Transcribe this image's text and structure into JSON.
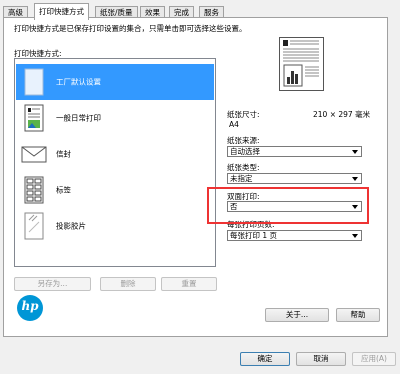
{
  "tabs": [
    "高级",
    "打印快捷方式",
    "纸张/质量",
    "效果",
    "完成",
    "服务"
  ],
  "active_tab": "打印快捷方式",
  "description": "打印快捷方式是已保存打印设置的集合，只需单击即可选择这些设置。",
  "shortcuts_label": "打印快捷方式:",
  "shortcuts": [
    {
      "label": "工厂默认设置",
      "icon": "blank-page-icon",
      "selected": true
    },
    {
      "label": "一般日常打印",
      "icon": "document-icon",
      "selected": false
    },
    {
      "label": "信封",
      "icon": "envelope-icon",
      "selected": false
    },
    {
      "label": "标签",
      "icon": "labels-icon",
      "selected": false
    },
    {
      "label": "投影胶片",
      "icon": "transparency-icon",
      "selected": false
    }
  ],
  "list_buttons": {
    "save_as": "另存为...",
    "delete": "删除",
    "reset": "重置"
  },
  "settings": {
    "paper_size": {
      "label": "纸张尺寸:",
      "dimensions": "210 × 297 毫米",
      "value": "A4"
    },
    "paper_source": {
      "label": "纸张来源:",
      "value": "自动选择"
    },
    "paper_type": {
      "label": "纸张类型:",
      "value": "未指定"
    },
    "duplex": {
      "label": "双面打印:",
      "value": "否"
    },
    "pages_per_sheet": {
      "label": "每张打印页数:",
      "value": "每张打印 1 页"
    }
  },
  "about_button": "关于...",
  "help_button": "帮助",
  "footer": {
    "ok": "确定",
    "cancel": "取消",
    "apply": "应用(A)"
  },
  "colors": {
    "selection": "#3399ff",
    "highlight": "#e33333",
    "hp_blue": "#0096d6"
  }
}
